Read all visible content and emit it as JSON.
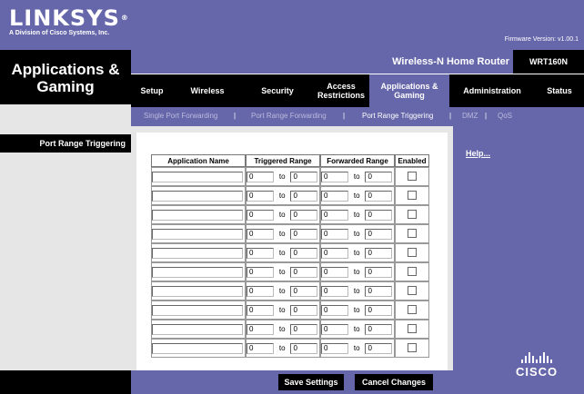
{
  "header": {
    "brand": "LINKSYS",
    "brand_mark": "®",
    "subtitle": "A Division of Cisco Systems, Inc.",
    "firmware": "Firmware Version: v1.00.1",
    "product": "Wireless-N Home Router",
    "model": "WRT160N"
  },
  "page": {
    "title_line1": "Applications &",
    "title_line2": "Gaming",
    "section_label": "Port Range Triggering"
  },
  "tabs": [
    {
      "label1": "Setup",
      "label2": ""
    },
    {
      "label1": "Wireless",
      "label2": ""
    },
    {
      "label1": "Security",
      "label2": ""
    },
    {
      "label1": "Access",
      "label2": "Restrictions"
    },
    {
      "label1": "Applications &",
      "label2": "Gaming"
    },
    {
      "label1": "Administration",
      "label2": ""
    },
    {
      "label1": "Status",
      "label2": ""
    }
  ],
  "subtabs": [
    "Single Port Forwarding",
    "Port Range Forwarding",
    "Port Range Triggering",
    "DMZ",
    "QoS"
  ],
  "subtab_separator": "|",
  "table": {
    "headers": [
      "Application Name",
      "Triggered Range",
      "Forwarded Range",
      "Enabled"
    ],
    "to_label": "to",
    "rows": [
      {
        "name": "",
        "trig_from": "0",
        "trig_to": "0",
        "fwd_from": "0",
        "fwd_to": "0",
        "enabled": false
      },
      {
        "name": "",
        "trig_from": "0",
        "trig_to": "0",
        "fwd_from": "0",
        "fwd_to": "0",
        "enabled": false
      },
      {
        "name": "",
        "trig_from": "0",
        "trig_to": "0",
        "fwd_from": "0",
        "fwd_to": "0",
        "enabled": false
      },
      {
        "name": "",
        "trig_from": "0",
        "trig_to": "0",
        "fwd_from": "0",
        "fwd_to": "0",
        "enabled": false
      },
      {
        "name": "",
        "trig_from": "0",
        "trig_to": "0",
        "fwd_from": "0",
        "fwd_to": "0",
        "enabled": false
      },
      {
        "name": "",
        "trig_from": "0",
        "trig_to": "0",
        "fwd_from": "0",
        "fwd_to": "0",
        "enabled": false
      },
      {
        "name": "",
        "trig_from": "0",
        "trig_to": "0",
        "fwd_from": "0",
        "fwd_to": "0",
        "enabled": false
      },
      {
        "name": "",
        "trig_from": "0",
        "trig_to": "0",
        "fwd_from": "0",
        "fwd_to": "0",
        "enabled": false
      },
      {
        "name": "",
        "trig_from": "0",
        "trig_to": "0",
        "fwd_from": "0",
        "fwd_to": "0",
        "enabled": false
      },
      {
        "name": "",
        "trig_from": "0",
        "trig_to": "0",
        "fwd_from": "0",
        "fwd_to": "0",
        "enabled": false
      }
    ]
  },
  "help_link": "Help...",
  "buttons": {
    "save": "Save Settings",
    "cancel": "Cancel Changes"
  },
  "footer_logo": "CISCO",
  "colors": {
    "brand_purple": "#6666aa",
    "black": "#000000",
    "gray": "#e6e6e6"
  }
}
